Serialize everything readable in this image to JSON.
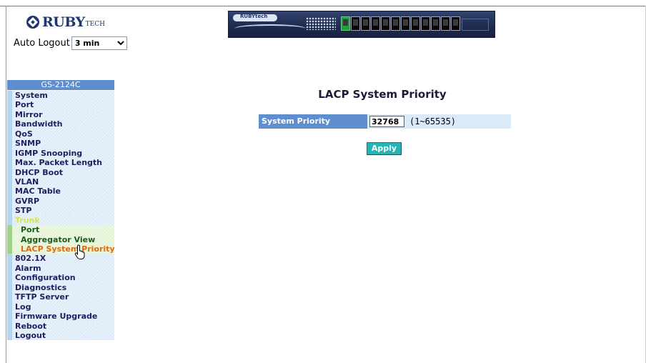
{
  "header": {
    "logo_text": "RUBY",
    "logo_sub": "TECH",
    "auto_logout_label": "Auto Logout",
    "auto_logout_value": "3 min",
    "device_brand": "RUBYtech"
  },
  "sidebar": {
    "model": "GS-2124C",
    "items": [
      {
        "label": "System"
      },
      {
        "label": "Port"
      },
      {
        "label": "Mirror"
      },
      {
        "label": "Bandwidth"
      },
      {
        "label": "QoS"
      },
      {
        "label": "SNMP"
      },
      {
        "label": "IGMP Snooping"
      },
      {
        "label": "Max. Packet Length"
      },
      {
        "label": "DHCP Boot"
      },
      {
        "label": "VLAN"
      },
      {
        "label": "MAC Table"
      },
      {
        "label": "GVRP"
      },
      {
        "label": "STP"
      },
      {
        "label": "Trunk"
      },
      {
        "label": "Port"
      },
      {
        "label": "Aggregator View"
      },
      {
        "label": "LACP System Priority"
      },
      {
        "label": "802.1X"
      },
      {
        "label": "Alarm"
      },
      {
        "label": "Configuration"
      },
      {
        "label": "Diagnostics"
      },
      {
        "label": "TFTP Server"
      },
      {
        "label": "Log"
      },
      {
        "label": "Firmware Upgrade"
      },
      {
        "label": "Reboot"
      },
      {
        "label": "Logout"
      }
    ]
  },
  "main": {
    "title": "LACP System Priority",
    "field_label": "System Priority",
    "field_value": "32768",
    "field_range": "(1~65535)",
    "apply_label": "Apply"
  },
  "colors": {
    "header_blue": "#5e8ece",
    "apply_teal": "#26b4b7",
    "active_orange": "#e06a0c"
  }
}
